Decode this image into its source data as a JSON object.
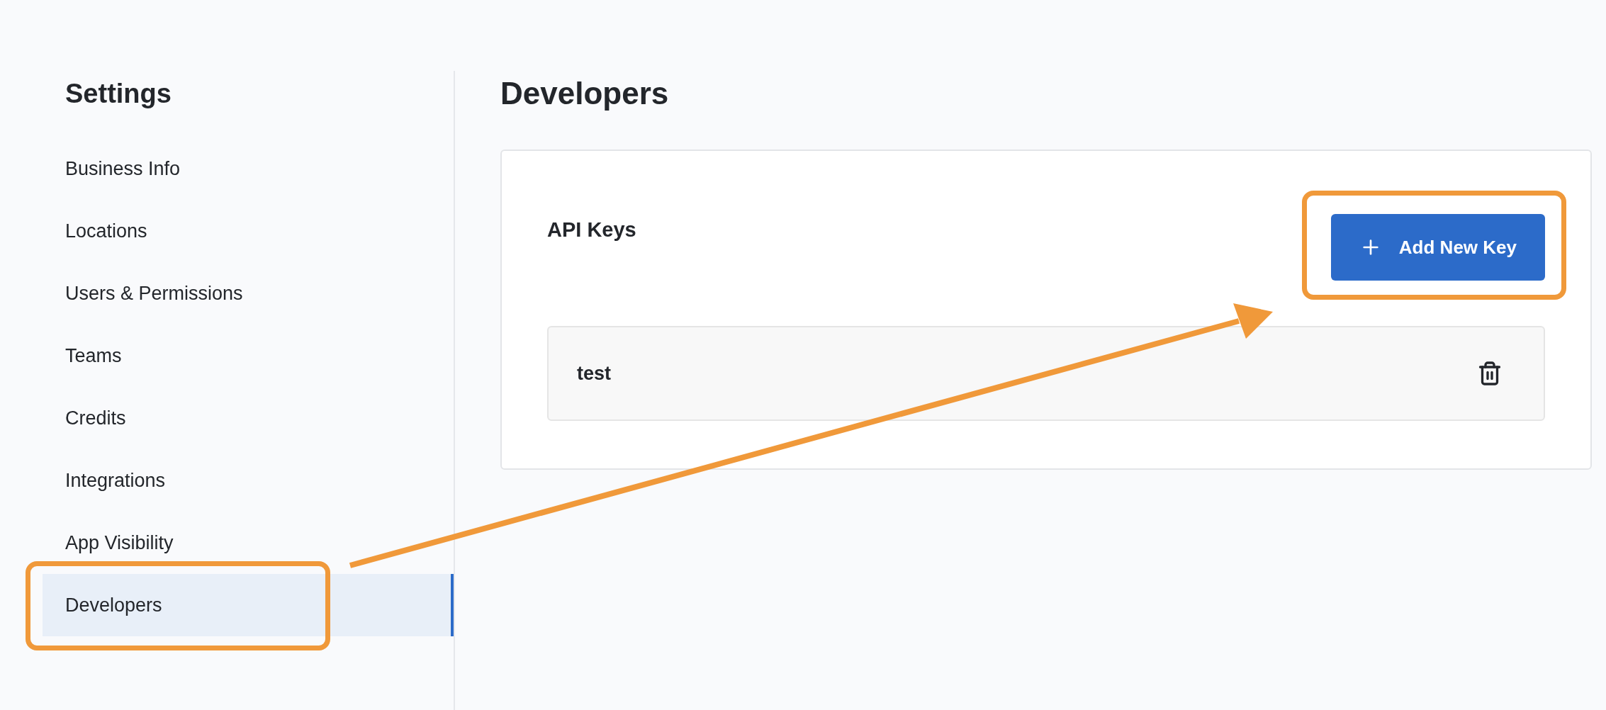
{
  "sidebar": {
    "title": "Settings",
    "items": [
      {
        "label": "Business Info",
        "selected": false
      },
      {
        "label": "Locations",
        "selected": false
      },
      {
        "label": "Users & Permissions",
        "selected": false
      },
      {
        "label": "Teams",
        "selected": false
      },
      {
        "label": "Credits",
        "selected": false
      },
      {
        "label": "Integrations",
        "selected": false
      },
      {
        "label": "App Visibility",
        "selected": false
      },
      {
        "label": "Developers",
        "selected": true
      }
    ]
  },
  "page": {
    "title": "Developers"
  },
  "api_keys": {
    "title": "API Keys",
    "add_button": "Add New Key",
    "keys": [
      {
        "name": "test"
      }
    ]
  }
}
